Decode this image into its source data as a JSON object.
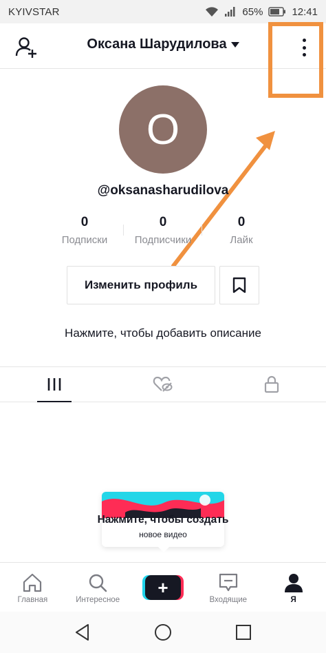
{
  "status_bar": {
    "carrier": "KYIVSTAR",
    "battery": "65%",
    "time": "12:41"
  },
  "header": {
    "title": "Оксана Шарудилова"
  },
  "profile": {
    "avatar_letter": "О",
    "username": "@oksanasharudilova",
    "stats": [
      {
        "value": "0",
        "label": "Подписки"
      },
      {
        "value": "0",
        "label": "Подписчики"
      },
      {
        "value": "0",
        "label": "Лайк"
      }
    ],
    "edit_button": "Изменить профиль",
    "bio_prompt": "Нажмите, чтобы добавить описание"
  },
  "tooltip": {
    "title": "Нажмите, чтобы создать",
    "subtitle": "новое видео"
  },
  "bottom_nav": {
    "home": "Главная",
    "discover": "Интересное",
    "inbox": "Входящие",
    "me": "Я"
  },
  "colors": {
    "highlight": "#f0913f",
    "avatar_bg": "#8c7068",
    "accent_cyan": "#20d5ec",
    "accent_red": "#fe2c55"
  },
  "icons": [
    "add-user-icon",
    "more-vert-icon",
    "bookmark-icon",
    "grid-icon",
    "liked-hidden-icon",
    "lock-icon",
    "home-icon",
    "search-icon",
    "plus-icon",
    "inbox-icon",
    "profile-icon",
    "back-icon",
    "home-circle-icon",
    "recents-icon"
  ]
}
